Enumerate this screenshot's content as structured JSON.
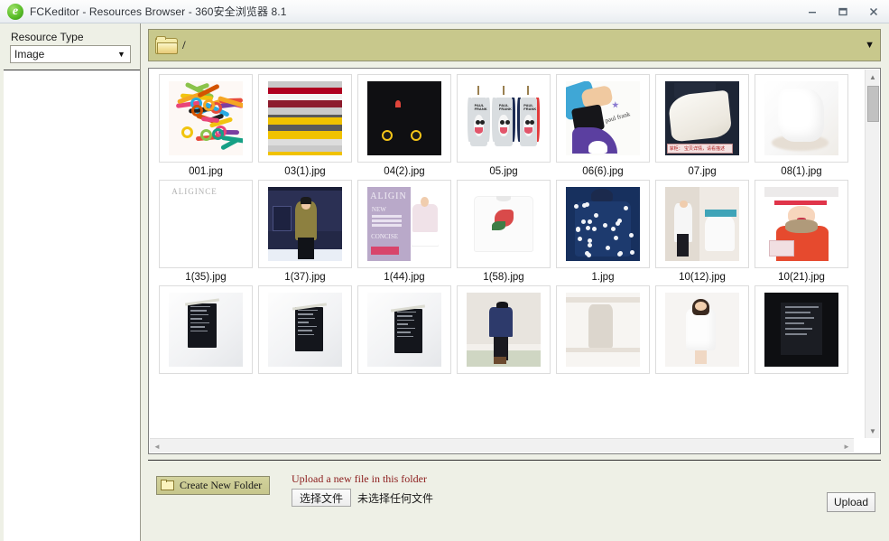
{
  "window": {
    "title": "FCKeditor - Resources Browser - 360安全浏览器 8.1",
    "icon": "browser-e-icon",
    "minimize_label": "–",
    "maximize_label": "▭",
    "close_label": "×"
  },
  "sidebar": {
    "resource_type_label": "Resource Type",
    "resource_type_value": "Image",
    "dropdown_arrow": "▼"
  },
  "pathbar": {
    "folder_icon": "folder-icon",
    "path": "/",
    "chevron": "▼"
  },
  "filelist": {
    "vscroll_up": "▲",
    "vscroll_down": "▼",
    "hscroll_left": "◄",
    "hscroll_right": "►",
    "files": [
      {
        "name": "001.jpg",
        "art": "a-ribbons"
      },
      {
        "name": "03(1).jpg",
        "art": "a-stripes"
      },
      {
        "name": "04(2).jpg",
        "art": "a-taxi"
      },
      {
        "name": "05.jpg",
        "art": "a-shirts"
      },
      {
        "name": "06(6).jpg",
        "art": "a-pfbag"
      },
      {
        "name": "07.jpg",
        "art": "a-fabric"
      },
      {
        "name": "08(1).jpg",
        "art": "a-white"
      },
      {
        "name": "1(35).jpg",
        "art": "a-mag"
      },
      {
        "name": "1(37).jpg",
        "art": "a-night"
      },
      {
        "name": "1(44).jpg",
        "art": "a-align"
      },
      {
        "name": "1(58).jpg",
        "art": "a-tee"
      },
      {
        "name": "1.jpg",
        "art": "a-stars"
      },
      {
        "name": "10(12).jpg",
        "art": "a-street"
      },
      {
        "name": "10(21).jpg",
        "art": "a-fashion"
      },
      {
        "name": "",
        "art": "a-tag"
      },
      {
        "name": "",
        "art": "a-tag"
      },
      {
        "name": "",
        "art": "a-tag"
      },
      {
        "name": "",
        "art": "a-model"
      },
      {
        "name": "",
        "art": "a-cat"
      },
      {
        "name": "",
        "art": "a-whitedress"
      },
      {
        "name": "",
        "art": "a-dkshirt"
      }
    ]
  },
  "bottombar": {
    "create_folder_label": "Create New Folder",
    "upload_hint": "Upload a new file in this folder",
    "choose_file_label": "选择文件",
    "no_file_label": "未选择任何文件",
    "upload_button_label": "Upload"
  },
  "colors": {
    "pathbar_bg": "#c8c88c",
    "window_bg": "#eef0e6",
    "upload_hint": "#8b1b1b",
    "edge_strip": "#3c7d8a"
  }
}
